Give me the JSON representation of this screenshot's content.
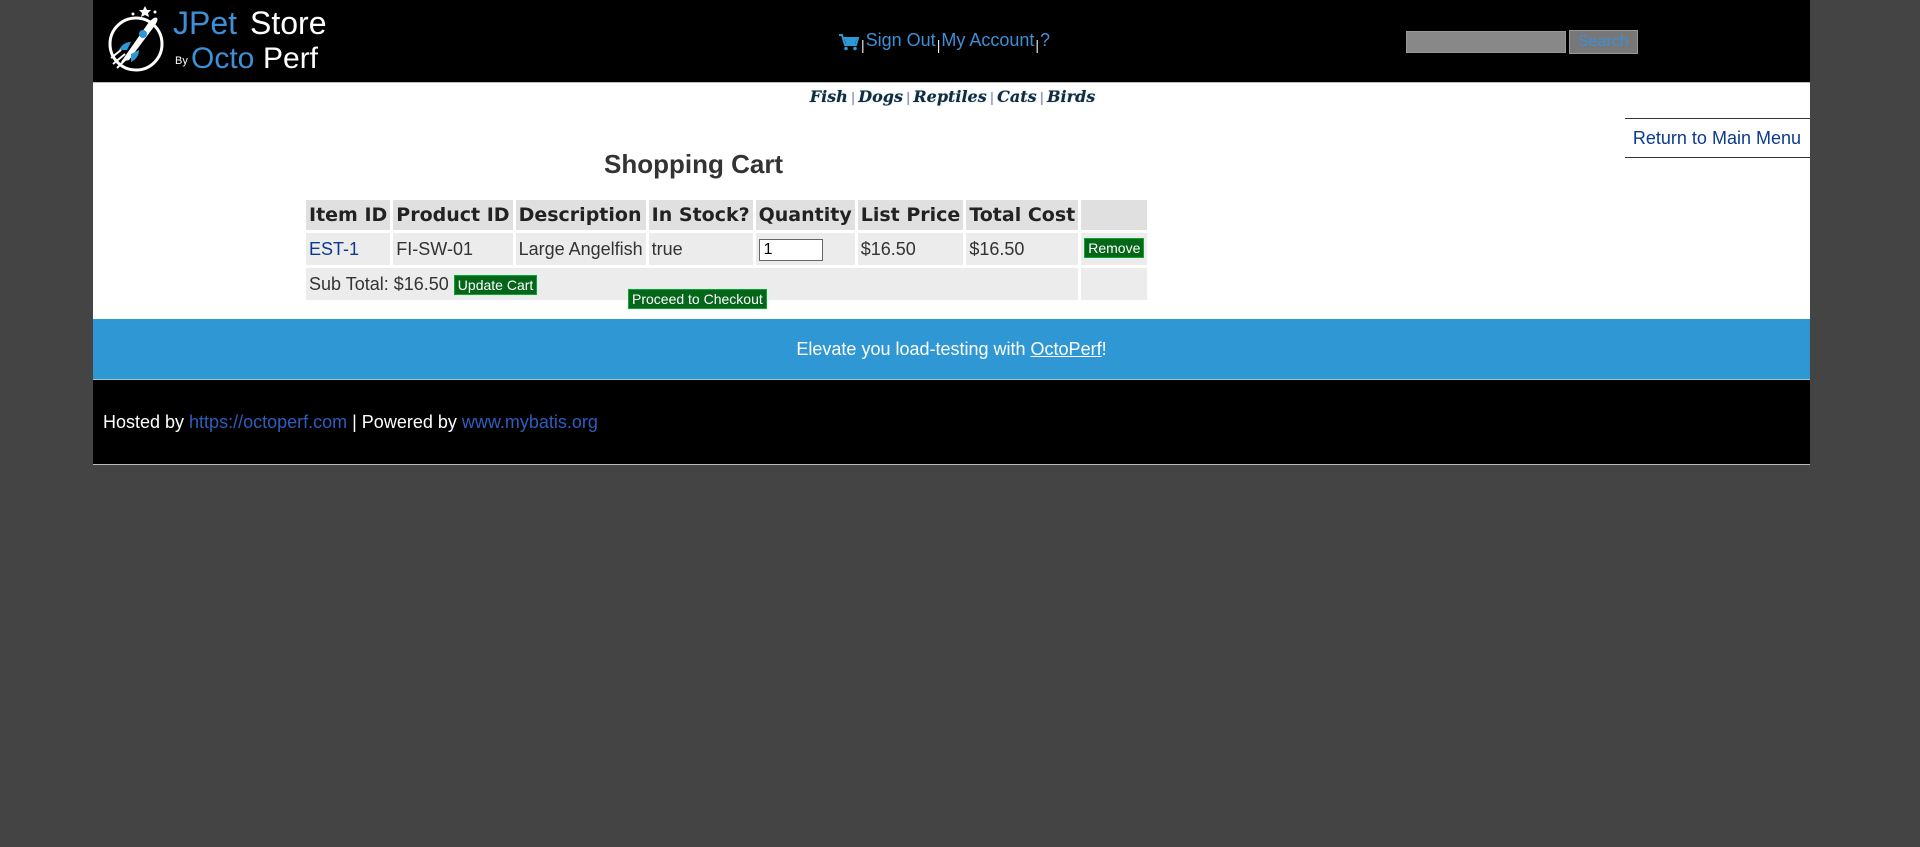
{
  "header": {
    "logo": {
      "brand_blue": "JPet",
      "brand_white": "Store",
      "by": "By",
      "octo": "Octo",
      "perf": "Perf"
    },
    "menu": {
      "sign_out": "Sign Out",
      "my_account": "My Account",
      "help": "?",
      "separator": "|"
    },
    "search": {
      "value": "",
      "button_label": "Search"
    }
  },
  "quicklinks": [
    "Fish",
    "Dogs",
    "Reptiles",
    "Cats",
    "Birds"
  ],
  "back_link": "Return to Main Menu",
  "cart": {
    "title": "Shopping Cart",
    "columns": [
      "Item ID",
      "Product ID",
      "Description",
      "In Stock?",
      "Quantity",
      "List Price",
      "Total Cost"
    ],
    "rows": [
      {
        "item_id": "EST-1",
        "product_id": "FI-SW-01",
        "description": "Large Angelfish",
        "in_stock": "true",
        "quantity": "1",
        "list_price": "$16.50",
        "total_cost": "$16.50",
        "remove_label": "Remove"
      }
    ],
    "subtotal_label": "Sub Total: $16.50",
    "update_label": "Update Cart",
    "checkout_label": "Proceed to Checkout"
  },
  "banner": {
    "prefix": "Elevate you load-testing with ",
    "link": "OctoPerf",
    "suffix": "!"
  },
  "footer": {
    "hosted_by": "Hosted by ",
    "hosted_link": "https://octoperf.com",
    "powered_by": " | Powered by ",
    "powered_link": "www.mybatis.org"
  },
  "colors": {
    "page_bg": "#444444",
    "header_bg": "#000000",
    "link_blue": "#3d8fd6",
    "button_green": "#05661a",
    "banner_blue": "#2f98d4"
  }
}
